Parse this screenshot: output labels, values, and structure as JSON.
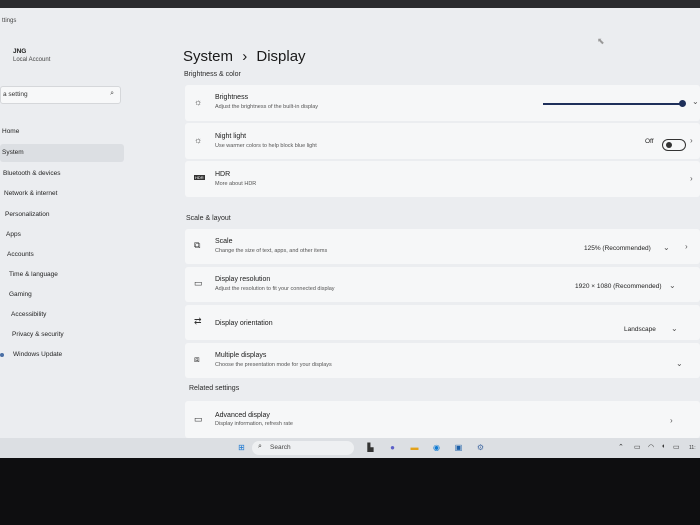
{
  "window": {
    "app_title": "ttings"
  },
  "sidebar": {
    "profile": {
      "name": "JNG",
      "account_type": "Local Account"
    },
    "search": {
      "placeholder": "a setting"
    },
    "items": [
      {
        "label": "Home"
      },
      {
        "label": "System"
      },
      {
        "label": "Bluetooth & devices"
      },
      {
        "label": "Network & internet"
      },
      {
        "label": "Personalization"
      },
      {
        "label": "Apps"
      },
      {
        "label": "Accounts"
      },
      {
        "label": "Time & language"
      },
      {
        "label": "Gaming"
      },
      {
        "label": "Accessibility"
      },
      {
        "label": "Privacy & security"
      },
      {
        "label": "Windows Update"
      }
    ]
  },
  "header": {
    "breadcrumb_parent": "System",
    "breadcrumb_sep": "›",
    "breadcrumb_current": "Display"
  },
  "sections": {
    "brightness_color": "Brightness & color",
    "scale_layout": "Scale & layout",
    "related": "Related settings"
  },
  "settings": {
    "brightness": {
      "title": "Brightness",
      "subtitle": "Adjust the brightness of the built-in display",
      "level": 1.0
    },
    "night_light": {
      "title": "Night light",
      "subtitle": "Use warmer colors to help block blue light",
      "state": "Off"
    },
    "hdr": {
      "title": "HDR",
      "subtitle": "More about HDR",
      "badge": "HDR"
    },
    "scale": {
      "title": "Scale",
      "subtitle": "Change the size of text, apps, and other items",
      "value": "125% (Recommended)"
    },
    "resolution": {
      "title": "Display resolution",
      "subtitle": "Adjust the resolution to fit your connected display",
      "value": "1920 × 1080 (Recommended)"
    },
    "orientation": {
      "title": "Display orientation",
      "value": "Landscape"
    },
    "multiple": {
      "title": "Multiple displays",
      "subtitle": "Choose the presentation mode for your displays"
    },
    "advanced": {
      "title": "Advanced display",
      "subtitle": "Display information, refresh rate"
    }
  },
  "taskbar": {
    "search_placeholder": "Search",
    "clock": "11:"
  },
  "colors": {
    "accent": "#1e2f5a",
    "background": "#ebedf0",
    "card": "#f6f7f8"
  }
}
